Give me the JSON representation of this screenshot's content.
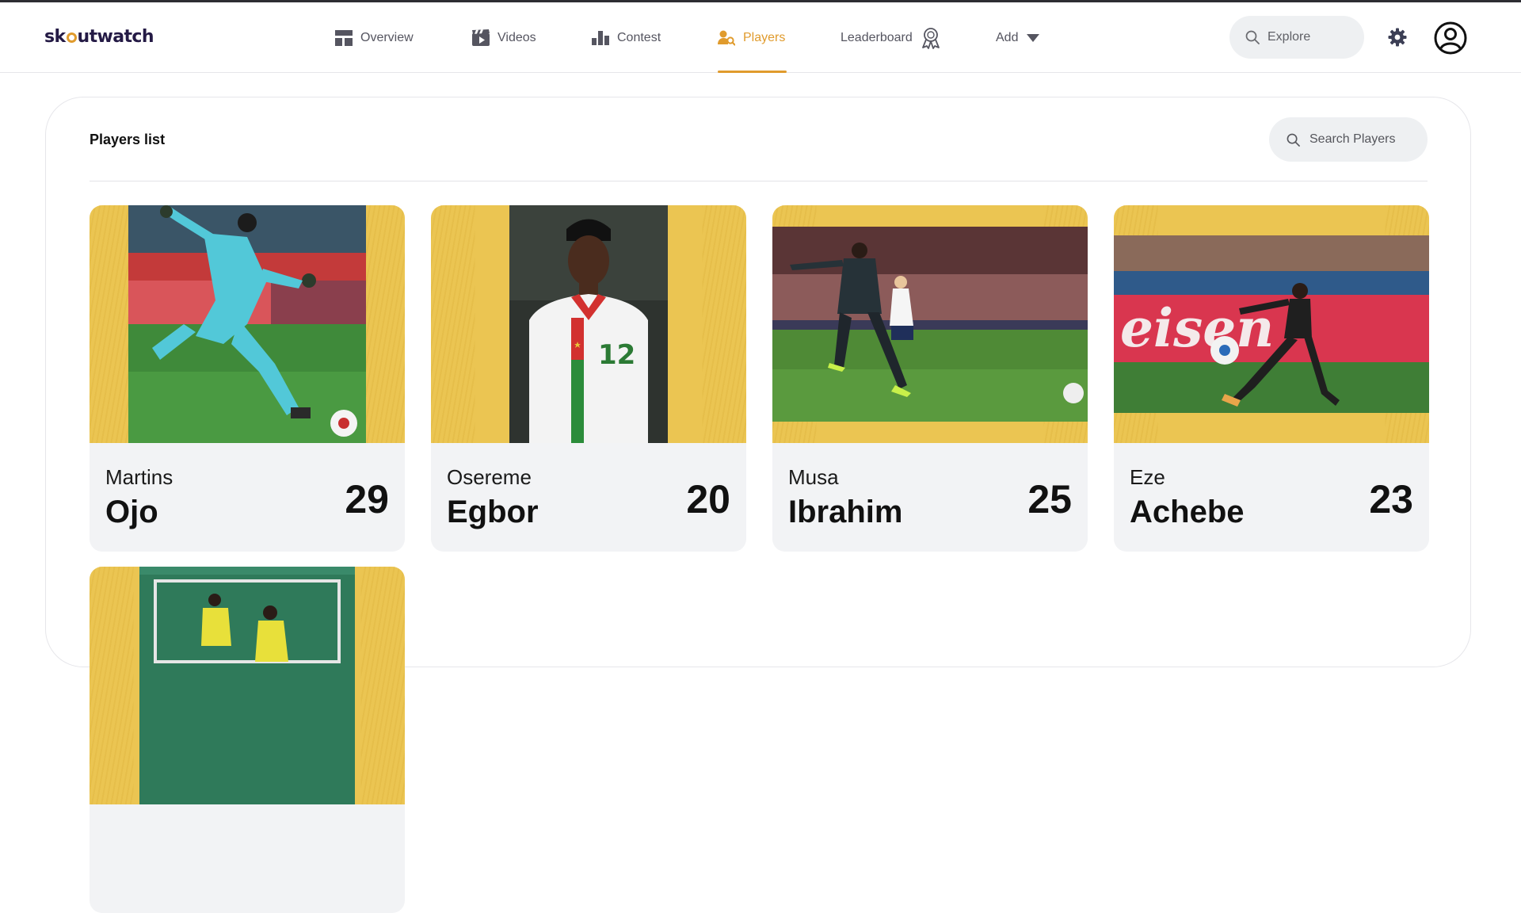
{
  "app": {
    "logo_left": "sk",
    "logo_right": "utwatch"
  },
  "nav": {
    "overview": "Overview",
    "videos": "Videos",
    "contest": "Contest",
    "players": "Players",
    "leaderboard": "Leaderboard",
    "add": "Add"
  },
  "header": {
    "explore_placeholder": "Explore"
  },
  "players_page": {
    "title": "Players list",
    "search_placeholder": "Search Players",
    "cards": [
      {
        "first": "Martins",
        "last": "Ojo",
        "age": "29"
      },
      {
        "first": "Osereme",
        "last": "Egbor",
        "age": "20"
      },
      {
        "first": "Musa",
        "last": "Ibrahim",
        "age": "25"
      },
      {
        "first": "Eze",
        "last": "Achebe",
        "age": "23"
      }
    ]
  },
  "colors": {
    "accent": "#e09b2d",
    "card_gold": "#ebc552",
    "card_base": "#f2f3f5"
  }
}
